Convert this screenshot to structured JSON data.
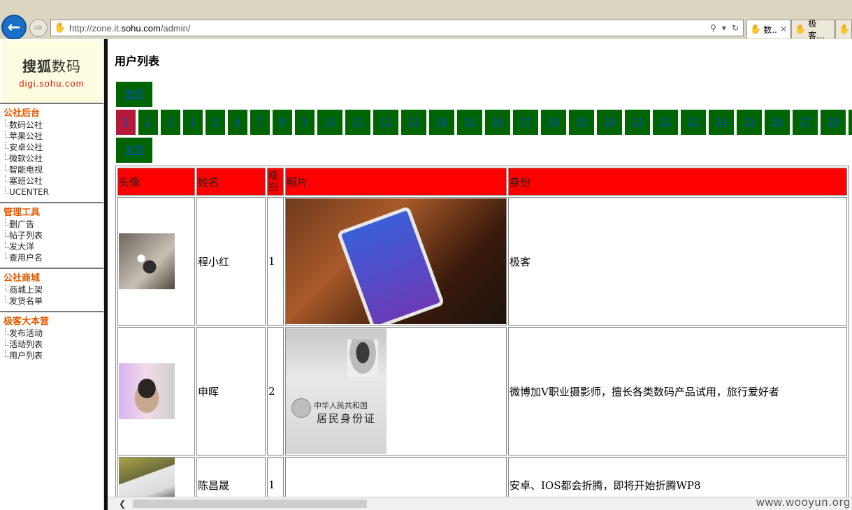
{
  "browser": {
    "url_prefix": "http://zone.it.",
    "url_domain": "sohu.com",
    "url_path": "/admin/",
    "tabs": [
      "数..",
      "极客...",
      ""
    ]
  },
  "sidebar": {
    "logo_main_a": "搜狐",
    "logo_main_b": "数码",
    "logo_sub": "digi.sohu.com",
    "groups": [
      {
        "title": "公社后台",
        "items": [
          "数码公社",
          "苹果公社",
          "安卓公社",
          "微软公社",
          "智能电视",
          "塞班公社",
          "UCENTER"
        ]
      },
      {
        "title": "管理工具",
        "items": [
          "删广告",
          "帖子列表",
          "发大洋",
          "查用户名"
        ]
      },
      {
        "title": "公社商城",
        "items": [
          "商城上架",
          "发货名单"
        ]
      },
      {
        "title": "极客大本营",
        "items": [
          "发布活动",
          "活动列表",
          "用户列表"
        ]
      }
    ]
  },
  "main": {
    "title": "用户列表",
    "first_label": "首页",
    "last_label": "末页",
    "pages": [
      "1",
      "2",
      "3",
      "4",
      "5",
      "6",
      "7",
      "8",
      "9",
      "10",
      "11",
      "12",
      "13",
      "14",
      "15",
      "16",
      "17",
      "18",
      "19",
      "20",
      "21",
      "22",
      "23",
      "24",
      "25",
      "26",
      "27",
      "28"
    ],
    "current_page": "1",
    "table": {
      "headers": [
        "头像",
        "姓名",
        "级别",
        "照片",
        "身份"
      ],
      "rows": [
        {
          "name": "程小红",
          "level": "1",
          "identity": "极客"
        },
        {
          "name": "申晖",
          "level": "2",
          "identity": "微博加V职业摄影师，擅长各类数码产品试用，旅行爱好者"
        },
        {
          "name": "陈昌晟",
          "level": "1",
          "identity": "安卓、IOS都会折腾，即将开始折腾WP8"
        }
      ],
      "id_card_text_1": "中华人民共和国",
      "id_card_text_2": "居民身份证"
    }
  },
  "watermark": "www.wooyun.org"
}
